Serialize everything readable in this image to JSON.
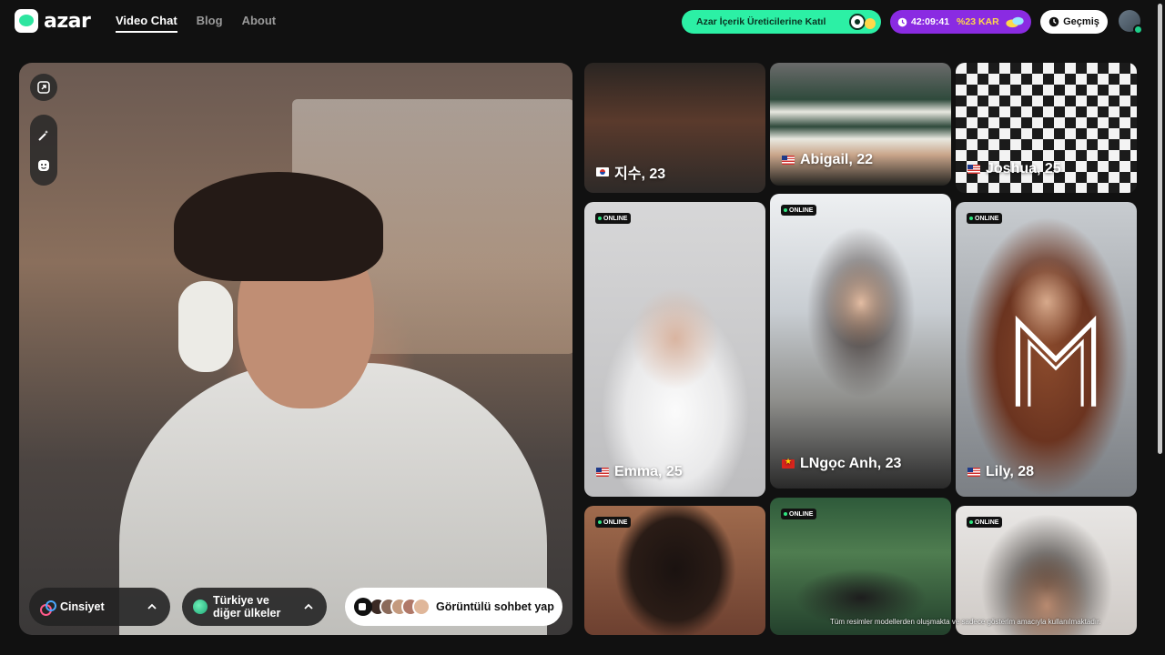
{
  "header": {
    "logo_text": "azar",
    "nav": [
      {
        "label": "Video Chat",
        "active": true
      },
      {
        "label": "Blog",
        "active": false
      },
      {
        "label": "About",
        "active": false
      }
    ],
    "creator_pill": "Azar İçerik Üreticilerine Katıl",
    "promo": {
      "timer": "42:09:41",
      "discount": "%23 KAR"
    },
    "history_label": "Geçmiş"
  },
  "video": {
    "filters": {
      "gender_label": "Cinsiyet",
      "region_line1": "Türkiye ve",
      "region_line2": "diğer ülkeler"
    },
    "start_label": "Görüntülü sohbet yap"
  },
  "cards": [
    {
      "name": "지수, 23",
      "flag": "kr",
      "online": false
    },
    {
      "name": "Abigail, 22",
      "flag": "us",
      "online": false
    },
    {
      "name": "Joshua, 25",
      "flag": "us",
      "online": false
    },
    {
      "name": "Emma, 25",
      "flag": "us",
      "online": true
    },
    {
      "name": "LNgọc Anh, 23",
      "flag": "vn",
      "online": true
    },
    {
      "name": "Lily, 28",
      "flag": "us",
      "online": true
    },
    {
      "name": "",
      "flag": "",
      "online": true
    },
    {
      "name": "",
      "flag": "",
      "online": true
    },
    {
      "name": "",
      "flag": "",
      "online": true
    }
  ],
  "online_label": "ONLINE",
  "disclaimer": "Tüm resimler modellerden oluşmakta ve sadece gösterim amacıyla kullanılmaktadır.",
  "colors": {
    "accent_green": "#2cf0a5",
    "promo_purple": "#8a2be2",
    "online_green": "#2ee57f"
  }
}
